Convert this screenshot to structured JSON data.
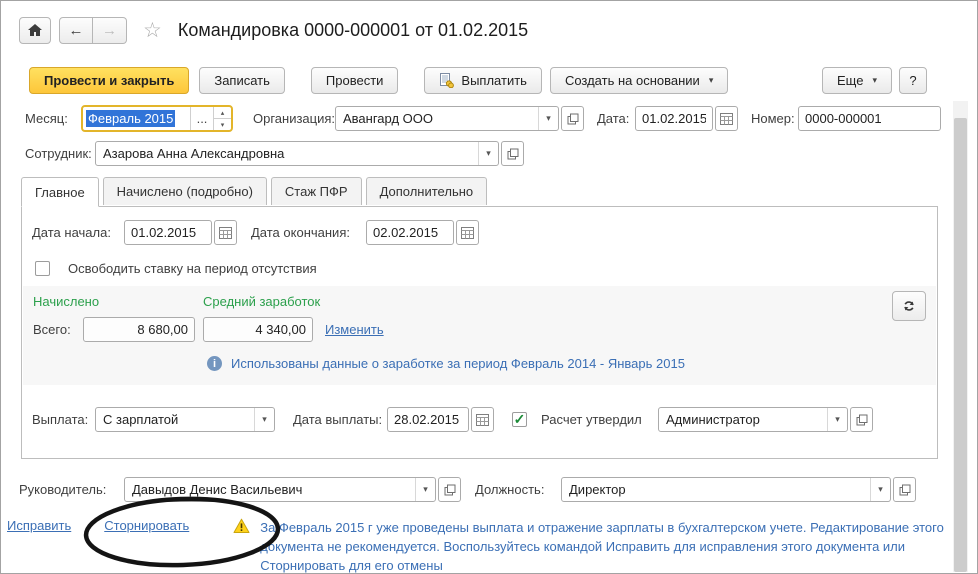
{
  "window": {
    "title": "Командировка 0000-000001 от 01.02.2015"
  },
  "toolbar": {
    "post_and_close": "Провести и закрыть",
    "write": "Записать",
    "post": "Провести",
    "pay": "Выплатить",
    "create_based_on": "Создать на основании",
    "more": "Еще",
    "help": "?"
  },
  "fields": {
    "month": {
      "label": "Месяц:",
      "value": "Февраль 2015",
      "dots": "..."
    },
    "organization": {
      "label": "Организация:",
      "value": "Авангард ООО"
    },
    "doc_date": {
      "label": "Дата:",
      "value": "01.02.2015"
    },
    "doc_number": {
      "label": "Номер:",
      "value": "0000-000001"
    },
    "employee": {
      "label": "Сотрудник:",
      "value": "Азарова Анна Александровна"
    }
  },
  "tabs": [
    {
      "label": "Главное"
    },
    {
      "label": "Начислено (подробно)"
    },
    {
      "label": "Стаж ПФР"
    },
    {
      "label": "Дополнительно"
    }
  ],
  "panel": {
    "start_date": {
      "label": "Дата начала:",
      "value": "01.02.2015"
    },
    "end_date": {
      "label": "Дата окончания:",
      "value": "02.02.2015"
    },
    "free_rate_label": "Освободить ставку на период отсутствия",
    "accrued_header": "Начислено",
    "avg_earnings_header": "Средний заработок",
    "total_label": "Всего:",
    "accrued_total": "8 680,00",
    "avg_total": "4 340,00",
    "change_link": "Изменить",
    "info_text": "Использованы данные о заработке за период Февраль 2014 - Январь 2015",
    "payment": {
      "label": "Выплата:",
      "value": "С зарплатой"
    },
    "payment_date": {
      "label": "Дата выплаты:",
      "value": "28.02.2015"
    },
    "approved_label": "Расчет утвердил",
    "approver": {
      "value": "Администратор"
    }
  },
  "footer": {
    "manager": {
      "label": "Руководитель:",
      "value": "Давыдов Денис Васильевич"
    },
    "position": {
      "label": "Должность:",
      "value": "Директор"
    },
    "correct_link": "Исправить",
    "reverse_link": "Сторнировать",
    "warning_text": "За Февраль 2015 г уже проведены выплата и отражение зарплаты в бухгалтерском учете. Редактирование этого документа не рекомендуется. Воспользуйтесь командой Исправить для исправления этого документа или Сторнировать для его отмены"
  },
  "colors": {
    "primary_button": "#fdc63a",
    "focus_border": "#e3b52a",
    "selection": "#3174d8",
    "link": "#3b6fb5",
    "section_green": "#2ca04c"
  }
}
